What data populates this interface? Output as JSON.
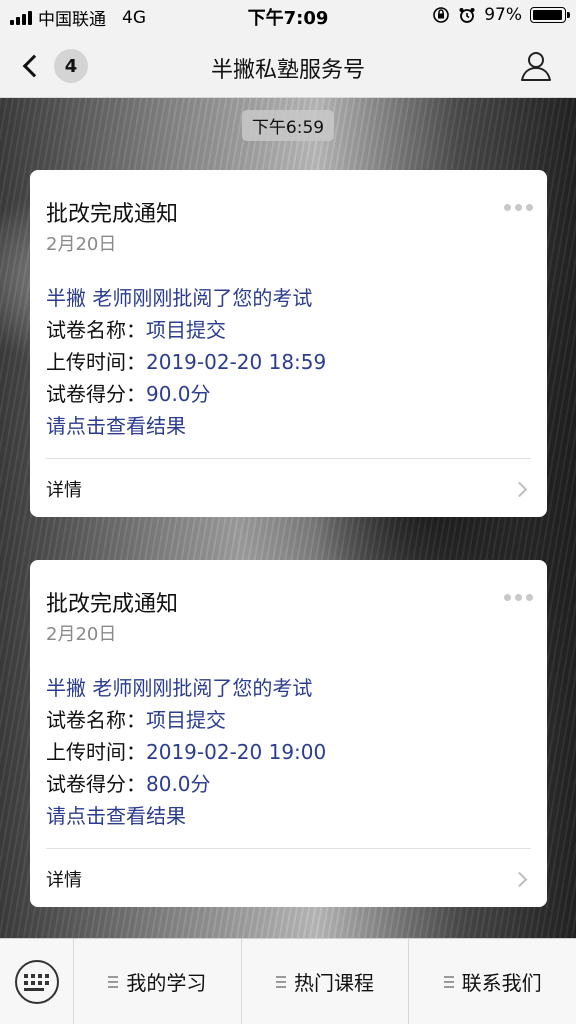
{
  "status_bar": {
    "carrier": "中国联通",
    "network": "4G",
    "time": "下午7:09",
    "battery_percent": "97%",
    "battery_level": 0.97
  },
  "nav": {
    "unread_count": "4",
    "title": "半撇私塾服务号",
    "back_icon": "chevron-left-icon",
    "profile_icon": "person-icon"
  },
  "chat": {
    "timestamp": "下午6:59",
    "messages": [
      {
        "title": "批改完成通知",
        "date": "2月20日",
        "intro": "半撇 老师刚刚批阅了您的考试",
        "name_label": "试卷名称：",
        "name_value": "项目提交",
        "upload_label": "上传时间：",
        "upload_value": "2019-02-20 18:59",
        "score_label": "试卷得分：",
        "score_value": "90.0分",
        "action": "请点击查看结果",
        "detail": "详情"
      },
      {
        "title": "批改完成通知",
        "date": "2月20日",
        "intro": "半撇 老师刚刚批阅了您的考试",
        "name_label": "试卷名称：",
        "name_value": "项目提交",
        "upload_label": "上传时间：",
        "upload_value": "2019-02-20 19:00",
        "score_label": "试卷得分：",
        "score_value": "80.0分",
        "action": "请点击查看结果",
        "detail": "详情"
      }
    ]
  },
  "menu": {
    "keyboard_icon": "keyboard-icon",
    "items": [
      {
        "label": "我的学习"
      },
      {
        "label": "热门课程"
      },
      {
        "label": "联系我们"
      }
    ]
  },
  "colors": {
    "link_blue": "#2c3d8f",
    "date_gray": "#8a8a8a"
  }
}
